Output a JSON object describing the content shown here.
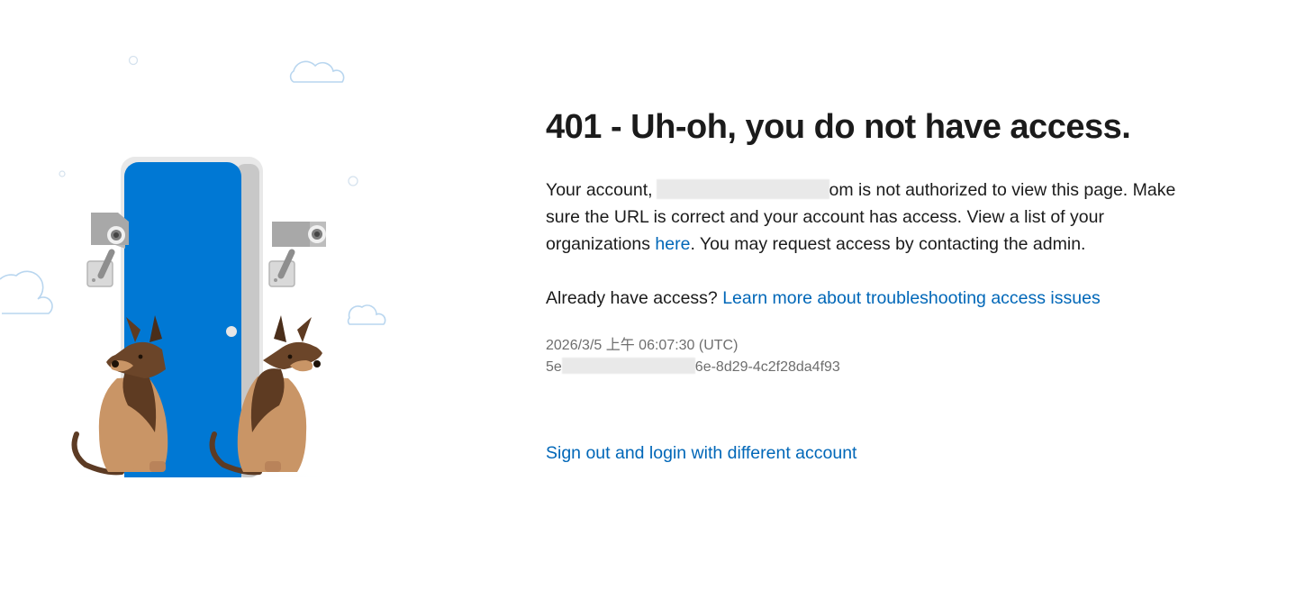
{
  "error": {
    "title": "401 - Uh-oh, you do not have access.",
    "message_part1": "Your account,",
    "email_suffix": "om is not authorized to view this page. Make sure the URL is correct and your account has access. View a list of your organizations ",
    "here_link": "here",
    "message_part2": ". You may request access by contacting the admin."
  },
  "help": {
    "prompt": "Already have access?",
    "link": "Learn more about troubleshooting access issues"
  },
  "meta": {
    "timestamp": "2026/3/5 上午 06:07:30 (UTC)",
    "correlation_prefix": "5e",
    "correlation_suffix": "6e-8d29-4c2f28da4f93"
  },
  "actions": {
    "signout": "Sign out and login with different account"
  },
  "colors": {
    "link": "#0067b8",
    "door": "#0078d4",
    "text": "#1b1b1b",
    "muted": "#6e6e6e"
  }
}
